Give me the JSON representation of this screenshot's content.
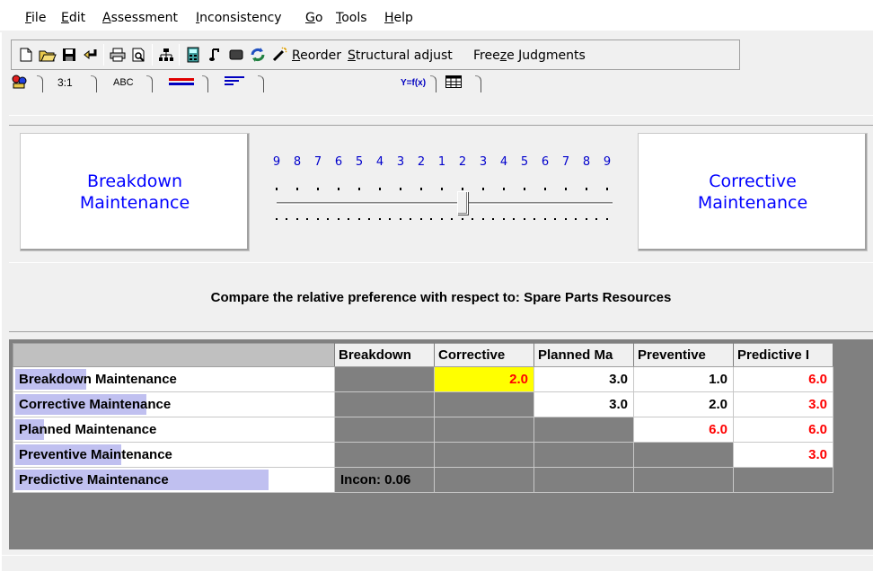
{
  "menu": [
    {
      "label": "File",
      "ul": "F"
    },
    {
      "label": "Edit",
      "ul": "E"
    },
    {
      "label": "Assessment",
      "ul": "A"
    },
    {
      "label": "Inconsistency",
      "ul": "I"
    },
    {
      "label": "Go",
      "ul": "G"
    },
    {
      "label": "Tools",
      "ul": "T"
    },
    {
      "label": "Help",
      "ul": "H"
    }
  ],
  "toolbar": {
    "reorder_label": "Reorder",
    "structural_label": "Structural adjust",
    "freeze_label": "Freeze Judgments"
  },
  "tabs": {
    "ratio_label": "3:1",
    "abc_label": "ABC",
    "formula_label": "Y=f(x)"
  },
  "comparison": {
    "left_item": "Breakdown Maintenance",
    "right_item": "Corrective Maintenance",
    "scale_left": [
      "9",
      "8",
      "7",
      "6",
      "5",
      "4",
      "3",
      "2"
    ],
    "scale_center": "1",
    "scale_right": [
      "2",
      "3",
      "4",
      "5",
      "6",
      "7",
      "8",
      "9"
    ],
    "slider_value": 2,
    "compare_text": "Compare the relative preference  with respect to: Spare Parts Resources"
  },
  "matrix": {
    "columns": [
      "Breakdown",
      "Corrective",
      "Planned Ma",
      "Preventive",
      "Predictive I"
    ],
    "rows": [
      {
        "label": "Breakdown Maintenance",
        "hl": 0.22
      },
      {
        "label": "Corrective Maintenance",
        "hl": 0.41
      },
      {
        "label": "Planned Maintenance",
        "hl": 0.09
      },
      {
        "label": "Preventive Maintenance",
        "hl": 0.33
      },
      {
        "label": "Predictive Maintenance",
        "hl": 0.79
      }
    ],
    "cells": [
      [
        "",
        "2.0",
        "3.0",
        "1.0",
        "6.0"
      ],
      [
        "",
        "",
        "3.0",
        "2.0",
        "3.0"
      ],
      [
        "",
        "",
        "",
        "6.0",
        "6.0"
      ],
      [
        "",
        "",
        "",
        "",
        "3.0"
      ],
      [
        "Incon: 0.06",
        "",
        "",
        "",
        ""
      ]
    ],
    "cell_colors": [
      [
        "dark",
        "yellow",
        "black",
        "black",
        "red"
      ],
      [
        "dark",
        "dark",
        "black",
        "black",
        "red"
      ],
      [
        "dark",
        "dark",
        "dark",
        "red",
        "red"
      ],
      [
        "dark",
        "dark",
        "dark",
        "dark",
        "red"
      ],
      [
        "incon",
        "dark",
        "dark",
        "dark",
        "dark"
      ]
    ]
  },
  "colors": {
    "accent_blue": "#0000ff",
    "highlight": "#ffff00",
    "inverted": "#ff0000",
    "row_bar": "#c0c0f0"
  }
}
